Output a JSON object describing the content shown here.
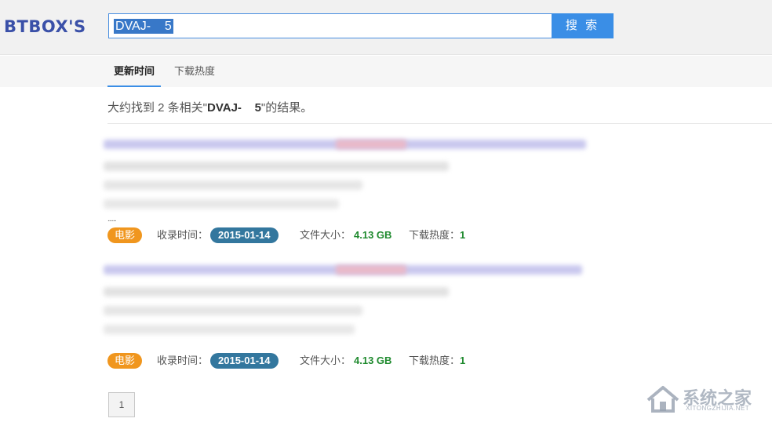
{
  "header": {
    "logo_text": "BTBOX'S",
    "search_value": "DVAJ-    5",
    "search_button_label": "搜 索"
  },
  "tabs": [
    {
      "label": "更新时间",
      "active": true
    },
    {
      "label": "下载热度",
      "active": false
    }
  ],
  "summary": {
    "prefix": "大约找到 2 条相关\"",
    "query": "DVAJ-    5",
    "suffix": "\"的结果。"
  },
  "results": [
    {
      "ellipsis": "......",
      "category": "电影",
      "collected_label": "收录时间：",
      "collected_date": "2015-01-14",
      "size_label": "文件大小：",
      "size_value": "4.13 GB",
      "heat_label": "下载热度：",
      "heat_value": "1"
    },
    {
      "ellipsis": "",
      "category": "电影",
      "collected_label": "收录时间：",
      "collected_date": "2015-01-14",
      "size_label": "文件大小：",
      "size_value": "4.13 GB",
      "heat_label": "下载热度：",
      "heat_value": "1"
    }
  ],
  "pagination": {
    "current_page": "1"
  },
  "watermark": {
    "text": "系统之家",
    "sub": "XITONGZHIJIA.NET"
  },
  "colors": {
    "accent": "#3a8ee6",
    "logo": "#3a50a8",
    "category_badge": "#f0961e",
    "date_badge": "#33779e",
    "value_green": "#1f8a2e"
  }
}
